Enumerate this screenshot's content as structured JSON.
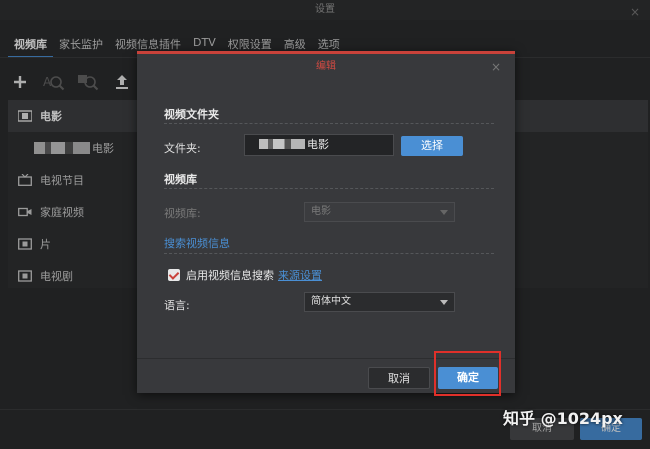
{
  "window": {
    "title": "设置",
    "close": "×"
  },
  "tabs": [
    {
      "label": "视频库",
      "active": true
    },
    {
      "label": "家长监护"
    },
    {
      "label": "视频信息插件"
    },
    {
      "label": "DTV"
    },
    {
      "label": "权限设置"
    },
    {
      "label": "高级"
    },
    {
      "label": "选项"
    }
  ],
  "toolbar": {
    "icons": [
      "add-icon",
      "search-metadata-icon",
      "rescan-icon",
      "upload-icon"
    ]
  },
  "libraries": [
    {
      "label": "电影",
      "icon": "movie-icon",
      "selected": true
    },
    {
      "label": "电影",
      "sub": true
    },
    {
      "label": "电视节目",
      "icon": "tv-icon"
    },
    {
      "label": "家庭视频",
      "icon": "camera-icon"
    },
    {
      "label": "片",
      "icon": "film-icon"
    },
    {
      "label": "电视剧",
      "icon": "film-icon"
    }
  ],
  "outer_buttons": {
    "cancel": "取消",
    "ok": "确定"
  },
  "dialog": {
    "title": "编辑",
    "close": "×",
    "folder_section": "视频文件夹",
    "folder_label": "文件夹:",
    "folder_value": "电影",
    "choose_button": "选择",
    "library_section": "视频库",
    "library_label": "视频库:",
    "library_value": "电影",
    "search_section": "搜索视频信息",
    "enable_search_label": "启用视频信息搜索",
    "enable_search_checked": true,
    "source_settings_link": "来源设置",
    "language_label": "语言:",
    "language_value": "简体中文",
    "cancel_button": "取消",
    "ok_button": "确定"
  },
  "watermark": "知乎 @1024px",
  "colors": {
    "accent": "#4a8fd4",
    "highlight": "#e0302a",
    "dialog_bar": "#c9423a"
  }
}
